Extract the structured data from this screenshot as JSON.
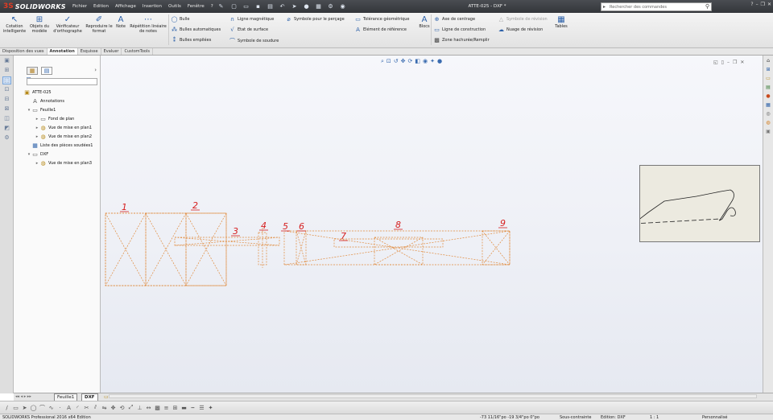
{
  "app": {
    "brand_prefix": "3S",
    "brand": "SOLIDWORKS",
    "window_title": "ATTE-025 - DXF *",
    "menus": [
      "Fichier",
      "Edition",
      "Affichage",
      "Insertion",
      "Outils",
      "Fenêtre",
      "?"
    ],
    "search_placeholder": "Rechercher des commandes"
  },
  "ribbon": {
    "big_buttons": [
      {
        "label": "Cotation intelligente",
        "icon": "smart-dimension-icon"
      },
      {
        "label": "Objets du modèle",
        "icon": "model-items-icon"
      },
      {
        "label": "Vérificateur d'orthographe",
        "icon": "spell-check-icon"
      },
      {
        "label": "Reproduire le format",
        "icon": "format-painter-icon"
      },
      {
        "label": "Note",
        "icon": "note-icon"
      },
      {
        "label": "Répétition linéaire de notes",
        "icon": "linear-note-pattern-icon"
      }
    ],
    "col1": [
      "Bulle",
      "Bulles automatiques",
      "Bulles empilées"
    ],
    "col2": [
      "Ligne magnétique",
      "Etat de surface",
      "Symbole de soudure"
    ],
    "col3": [
      "Symbole pour le perçage"
    ],
    "col4": [
      "Tolérance géométrique",
      "Elément de référence"
    ],
    "blocs": "Blocs",
    "col5": [
      "Axe de centrage",
      "Ligne de construction",
      "Zone hachurée/Remplir"
    ],
    "col6": [
      "Symbole de révision",
      "Nuage de révision"
    ],
    "tables": "Tables"
  },
  "tabs": [
    "Disposition des vues",
    "Annotation",
    "Esquisse",
    "Evaluer",
    "CustomTools"
  ],
  "active_tab": "Annotation",
  "tree": {
    "root": "ATTE-025",
    "items": [
      {
        "label": "Annotations",
        "depth": 1,
        "icon": "annotations-icon",
        "twisty": ""
      },
      {
        "label": "Feuille1",
        "depth": 1,
        "icon": "sheet-icon",
        "twisty": "▾"
      },
      {
        "label": "Fond de plan",
        "depth": 2,
        "icon": "sheet-format-icon",
        "twisty": "▸"
      },
      {
        "label": "Vue de mise en plan1",
        "depth": 2,
        "icon": "drawing-view-icon",
        "twisty": "▸"
      },
      {
        "label": "Vue de mise en plan2",
        "depth": 2,
        "icon": "drawing-view-icon",
        "twisty": "▸"
      },
      {
        "label": "Liste des pièces soudées1",
        "depth": 1,
        "icon": "weldment-list-icon",
        "twisty": ""
      },
      {
        "label": "DXF",
        "depth": 1,
        "icon": "sheet-icon",
        "twisty": "▾"
      },
      {
        "label": "Vue de mise en plan3",
        "depth": 2,
        "icon": "drawing-view-icon",
        "twisty": "▸"
      }
    ]
  },
  "sheet_tabs": [
    "Feuille1",
    "DXF"
  ],
  "active_sheet": "DXF",
  "callouts": [
    "1",
    "2",
    "3",
    "4",
    "5",
    "6",
    "7",
    "8",
    "9"
  ],
  "status": {
    "product": "SOLIDWORKS Professional 2016 x64 Edition",
    "coords": "-73 11/16\"po   -19 3/4\"po   0\"po",
    "state": "Sous-contrainte",
    "editing": "Edition: DXF",
    "scale": "1 : 1",
    "units": "Personnalisé"
  },
  "colors": {
    "accent": "#2a5fa8",
    "drawing": "#e08a3c",
    "callout": "#d62020",
    "brand": "#e03b24"
  }
}
